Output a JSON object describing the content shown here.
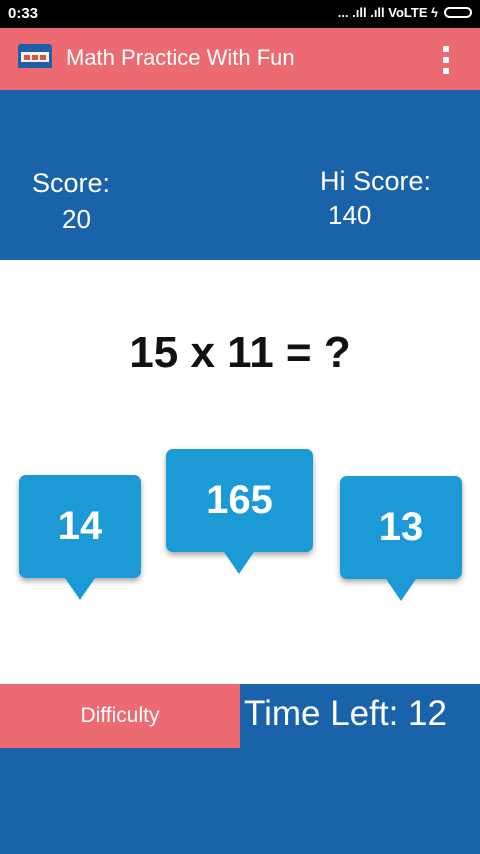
{
  "status_bar": {
    "time": "0:33",
    "network_text": "... .ıll .ıll VoLTE ϟ",
    "icons": [
      "signal-icon",
      "signal-icon",
      "charging-icon",
      "battery-icon"
    ]
  },
  "app_bar": {
    "title": "Math Practice With Fun",
    "icon": "app-logo-icon",
    "menu_icon": "overflow-menu-icon",
    "color": "#ec6b73"
  },
  "score_panel": {
    "score_label": "Score:",
    "score_value": "20",
    "hi_score_label": "Hi Score:",
    "hi_score_value": "140",
    "color": "#1a63ab"
  },
  "question": {
    "text": "15 x 11 = ?"
  },
  "answers": [
    {
      "label": "14"
    },
    {
      "label": "165"
    },
    {
      "label": "13"
    }
  ],
  "answer_color": "#1b9ad6",
  "footer": {
    "difficulty_label": "Difficulty",
    "time_left_text": "Time Left: 12"
  }
}
